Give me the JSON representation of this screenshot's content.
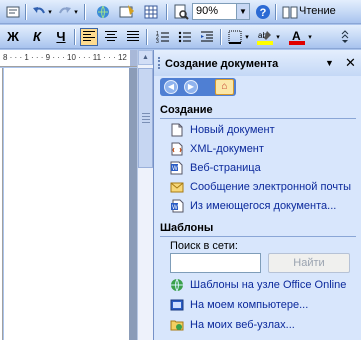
{
  "toolbar": {
    "zoom_value": "90%",
    "read_label": "Чтение",
    "font_italic": "К",
    "font_bold": "Ж",
    "font_underline": "Ч"
  },
  "ruler": {
    "text": "8 · · · 1 · · · 9 · · · 10 · · · 11 · · · 12 ·"
  },
  "pane": {
    "title": "Создание документа",
    "create_heading": "Создание",
    "create_items": [
      {
        "label": "Новый документ",
        "icon": "blank-document-icon"
      },
      {
        "label": "XML-документ",
        "icon": "xml-document-icon"
      },
      {
        "label": "Веб-страница",
        "icon": "web-page-icon"
      },
      {
        "label": "Сообщение электронной почты",
        "icon": "envelope-icon"
      },
      {
        "label": "Из имеющегося документа...",
        "icon": "document-from-existing-icon"
      }
    ],
    "templates_heading": "Шаблоны",
    "search_label": "Поиск в сети:",
    "search_value": "",
    "go_label": "Найти",
    "template_items": [
      {
        "label": "Шаблоны на узле Office Online",
        "icon": "office-online-icon"
      },
      {
        "label": "На моем компьютере...",
        "icon": "my-computer-icon"
      },
      {
        "label": "На моих веб-узлах...",
        "icon": "web-folders-icon"
      }
    ]
  },
  "colors": {
    "link": "#0c2a9c",
    "pane_bg": "#d8e6fc",
    "highlight_yellow": "#ffff00",
    "font_red": "#e00000"
  }
}
